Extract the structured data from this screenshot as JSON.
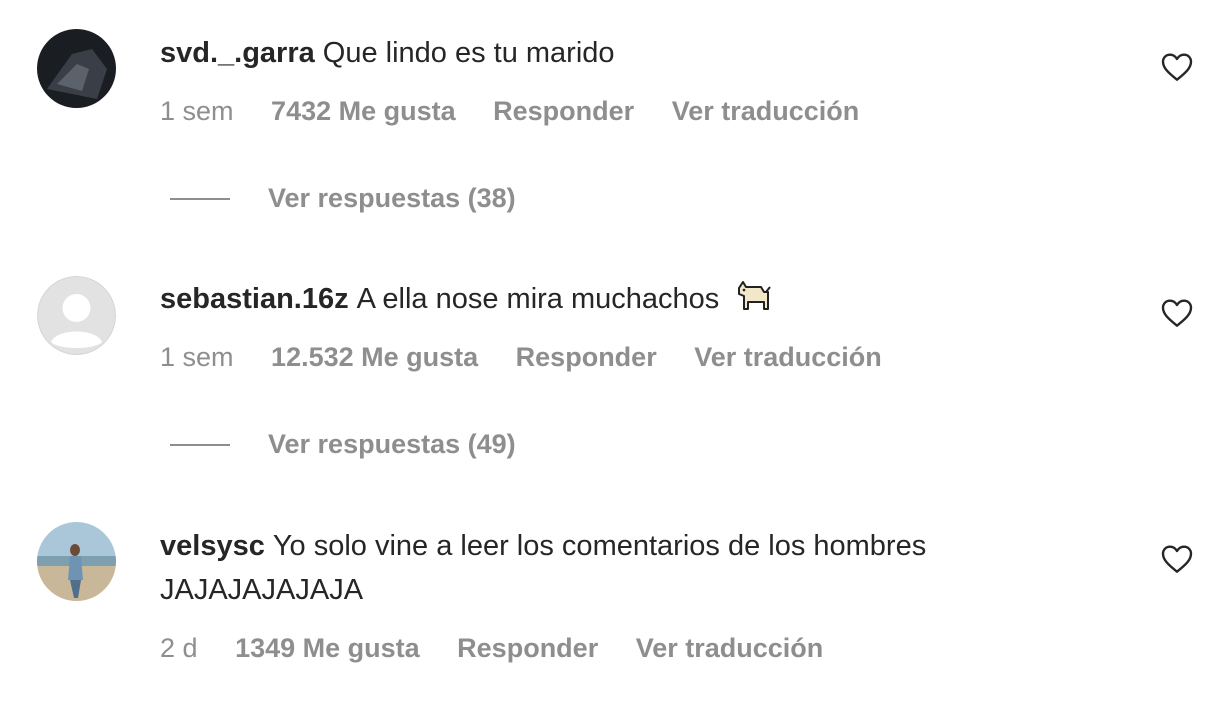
{
  "comments": [
    {
      "username": "svd._.garra",
      "text": "Que lindo es tu marido",
      "time": "1 sem",
      "likes": "7432 Me gusta",
      "reply": "Responder",
      "translate": "Ver traducción",
      "view_replies": "Ver respuestas (38)"
    },
    {
      "username": "sebastian.16z",
      "text": "A ella nose mira muchachos",
      "emoji": "dog-emoji",
      "time": "1 sem",
      "likes": "12.532 Me gusta",
      "reply": "Responder",
      "translate": "Ver traducción",
      "view_replies": "Ver respuestas (49)"
    },
    {
      "username": "velsysc",
      "text": "Yo solo vine a leer los comentarios de los hombres JAJAJAJAJAJA",
      "time": "2 d",
      "likes": "1349 Me gusta",
      "reply": "Responder",
      "translate": "Ver traducción"
    }
  ],
  "colors": {
    "text": "#262626",
    "secondary": "#8e8e8e"
  },
  "icons": [
    "heart-icon",
    "avatar",
    "dog-emoji"
  ]
}
